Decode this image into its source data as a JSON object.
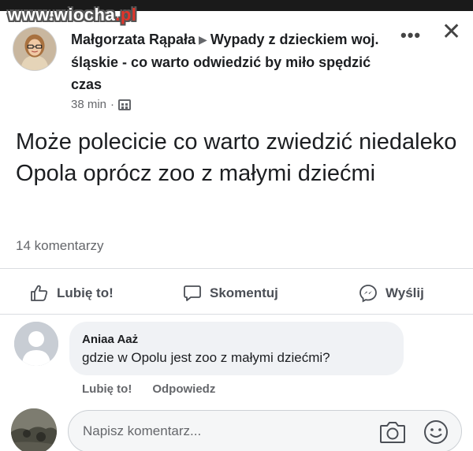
{
  "watermark": {
    "name": "www.wiocha",
    "domain": ".pl"
  },
  "post": {
    "author": "Małgorzata Rąpała",
    "arrow": "▶",
    "group": "Wypady z dzieckiem woj. śląskie - co warto odwiedzić by miło spędzić czas",
    "time": "38 min",
    "separator": "·",
    "body": "Może polecicie co warto zwiedzić niedaleko Opola oprócz zoo z małymi dziećmi",
    "comment_count": "14 komentarzy",
    "more_label": "•••",
    "close_label": "✕"
  },
  "actions": {
    "like": "Lubię to!",
    "comment": "Skomentuj",
    "send": "Wyślij"
  },
  "comment": {
    "author": "Aniaa Aaż",
    "text": "gdzie w Opolu jest zoo z małymi dziećmi?",
    "like": "Lubię to!",
    "reply": "Odpowiedz"
  },
  "composer": {
    "placeholder": "Napisz komentarz..."
  },
  "colors": {
    "watermark_domain": "#e2342a",
    "secondary_text": "#65676b",
    "bubble": "#f0f2f5"
  }
}
